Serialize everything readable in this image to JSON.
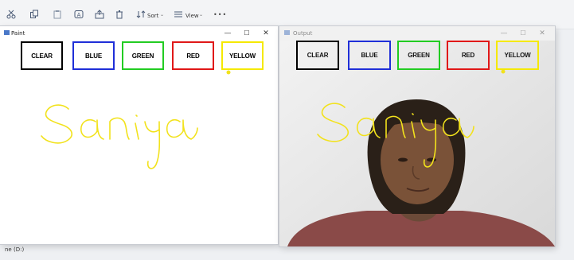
{
  "toolbar": {
    "sort_label": "Sort",
    "view_label": "View",
    "more_label": "•••"
  },
  "statusbar": {
    "drive_label": "ne (D:)"
  },
  "paint_window": {
    "title": "Paint",
    "buttons": [
      "CLEAR",
      "BLUE",
      "GREEN",
      "RED",
      "YELLOW"
    ],
    "text_drawn": "Saniya"
  },
  "output_window": {
    "title": "Output",
    "buttons": [
      "CLEAR",
      "BLUE",
      "GREEN",
      "RED",
      "YELLOW"
    ],
    "text_drawn": "Saniya"
  },
  "colors": {
    "clear": "#000000",
    "blue": "#1f2fd8",
    "green": "#22cc22",
    "red": "#e01818",
    "yellow": "#f5e900",
    "ink": "#f2e21c"
  },
  "window_controls": {
    "minimize": "—",
    "maximize": "☐",
    "close": "✕"
  }
}
